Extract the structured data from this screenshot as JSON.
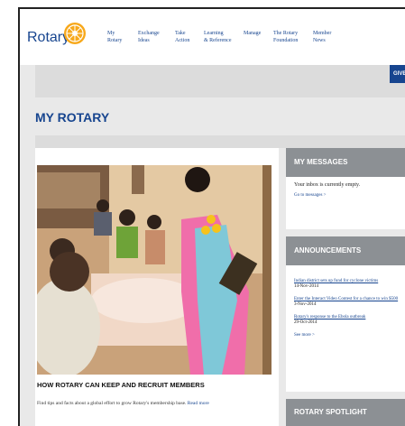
{
  "header": {
    "logo_text": "Rotary",
    "nav": [
      {
        "line1": "My",
        "line2": "Rotary"
      },
      {
        "line1": "Exchange",
        "line2": "Ideas"
      },
      {
        "line1": "Take",
        "line2": "Action"
      },
      {
        "line1": "Learning",
        "line2": "& Reference"
      },
      {
        "line1": "Manage",
        "line2": ""
      },
      {
        "line1": "The Rotary",
        "line2": "Foundation"
      },
      {
        "line1": "Member",
        "line2": "News"
      }
    ]
  },
  "give_button": "GIVE",
  "page_title": "MY ROTARY",
  "story": {
    "title": "HOW ROTARY CAN KEEP AND RECRUIT MEMBERS",
    "text": "Find tips and facts about a global effort to grow Rotary's membership base.",
    "read_more": "Read more"
  },
  "messages": {
    "heading": "MY MESSAGES",
    "empty_text": "Your inbox is currently empty.",
    "link": "Go to messages >"
  },
  "announcements": {
    "heading": "ANNOUNCEMENTS",
    "items": [
      {
        "title": "Indian district sets up fund for cyclone victims",
        "date": "14-Nov-2014"
      },
      {
        "title": "Enter the Interact Video Contest for a chance to win $500",
        "date": "3-Nov-2014"
      },
      {
        "title": "Rotary's response to the Ebola outbreak",
        "date": "29-Oct-2014"
      }
    ],
    "see_more": "See more >"
  },
  "spotlight": {
    "heading": "ROTARY SPOTLIGHT"
  },
  "colors": {
    "brand_blue": "#17458f",
    "rotary_gold": "#f7a81b",
    "panel_gray": "#8c9094"
  }
}
